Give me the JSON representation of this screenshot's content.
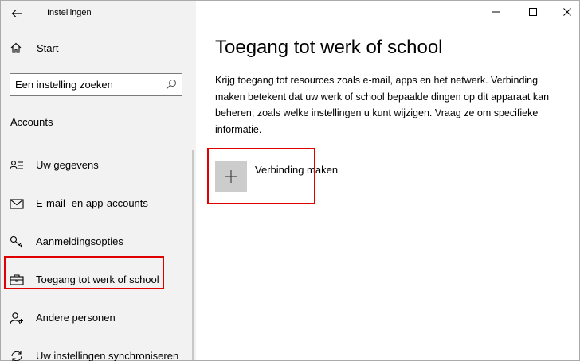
{
  "window": {
    "title": "Instellingen"
  },
  "sidebar": {
    "start_label": "Start",
    "search_placeholder": "Een instelling zoeken",
    "section_header": "Accounts",
    "items": [
      {
        "label": "Uw gegevens",
        "icon": "user-info-icon"
      },
      {
        "label": "E-mail- en app-accounts",
        "icon": "mail-icon"
      },
      {
        "label": "Aanmeldingsopties",
        "icon": "key-icon"
      },
      {
        "label": "Toegang tot werk of school",
        "icon": "briefcase-icon",
        "selected": true
      },
      {
        "label": "Andere personen",
        "icon": "person-add-icon"
      },
      {
        "label": "Uw instellingen synchroniseren",
        "icon": "sync-icon"
      }
    ]
  },
  "main": {
    "title": "Toegang tot werk of school",
    "description": "Krijg toegang tot resources zoals e-mail, apps en het netwerk. Verbinding maken betekent dat uw werk of school bepaalde dingen op dit apparaat kan beheren, zoals welke instellingen u kunt wijzigen. Vraag ze om specifieke informatie.",
    "connect_label": "Verbinding maken"
  },
  "colors": {
    "highlight": "#e00000",
    "sidebar_bg": "#f2f2f2",
    "tile_bg": "#cccccc"
  }
}
